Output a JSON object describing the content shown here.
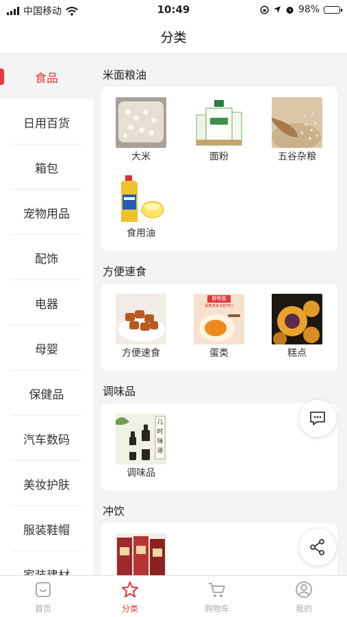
{
  "status_bar": {
    "carrier": "中国移动",
    "time": "10:49",
    "battery": "98%",
    "icons": [
      "signal-icon",
      "wifi-icon",
      "orientation-lock-icon",
      "location-icon",
      "alarm-icon",
      "battery-icon"
    ]
  },
  "navbar": {
    "title": "分类"
  },
  "sidebar": {
    "items": [
      {
        "label": "食品",
        "active": true
      },
      {
        "label": "日用百货"
      },
      {
        "label": "箱包"
      },
      {
        "label": "宠物用品"
      },
      {
        "label": "配饰"
      },
      {
        "label": "电器"
      },
      {
        "label": "母婴"
      },
      {
        "label": "保健品"
      },
      {
        "label": "汽车数码"
      },
      {
        "label": "美妆护肤"
      },
      {
        "label": "服装鞋帽"
      },
      {
        "label": "家装建材"
      }
    ]
  },
  "sections": [
    {
      "title": "米面粮油",
      "items": [
        {
          "label": "大米",
          "image": "rice"
        },
        {
          "label": "面粉",
          "image": "flour"
        },
        {
          "label": "五谷杂粮",
          "image": "grains"
        },
        {
          "label": "食用油",
          "image": "oil"
        }
      ]
    },
    {
      "title": "方便速食",
      "items": [
        {
          "label": "方便速食",
          "image": "instant-food"
        },
        {
          "label": "蛋类",
          "image": "eggs"
        },
        {
          "label": "糕点",
          "image": "pastry"
        }
      ]
    },
    {
      "title": "调味品",
      "items": [
        {
          "label": "调味品",
          "image": "condiments"
        }
      ]
    },
    {
      "title": "冲饮",
      "items": [
        {
          "label": "",
          "image": "drinks"
        }
      ]
    }
  ],
  "product_image_text": {
    "eggs_banner": "野鸭蛋",
    "eggs_sub": "蛋黄流油 粒粒可口",
    "condiment_banner": "儿时味道"
  },
  "fabs": {
    "chat_icon": "chat-icon",
    "share_icon": "share-icon"
  },
  "tabbar": {
    "tabs": [
      {
        "label": "首页",
        "icon": "home-icon"
      },
      {
        "label": "分类",
        "icon": "category-star-icon",
        "active": true
      },
      {
        "label": "购物车",
        "icon": "cart-icon"
      },
      {
        "label": "我的",
        "icon": "profile-icon"
      }
    ]
  },
  "colors": {
    "accent": "#e4393c",
    "background": "#f4f4f4",
    "card": "#ffffff"
  }
}
